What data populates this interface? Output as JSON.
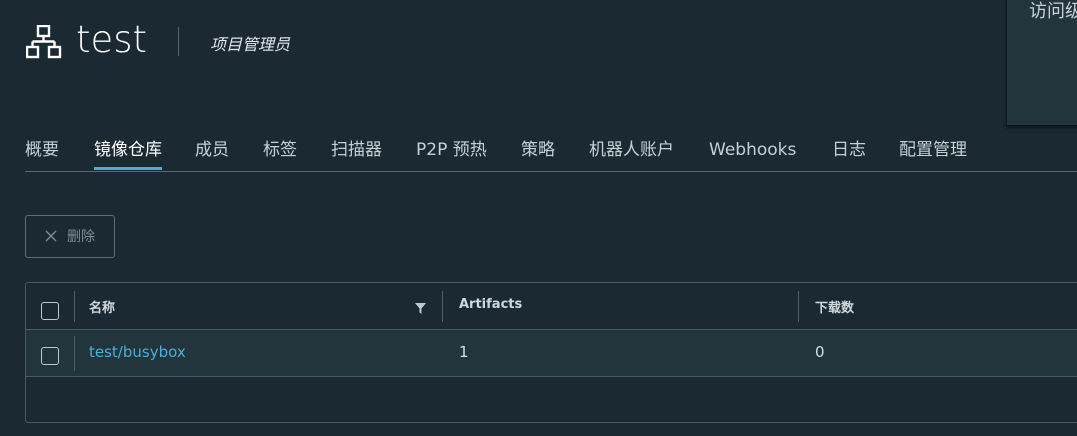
{
  "header": {
    "project_name": "test",
    "role": "项目管理员",
    "icon": "project-tree-icon"
  },
  "popover": {
    "text": "访问级别"
  },
  "tabs": [
    {
      "label": "概要",
      "active": false
    },
    {
      "label": "镜像仓库",
      "active": true
    },
    {
      "label": "成员",
      "active": false
    },
    {
      "label": "标签",
      "active": false
    },
    {
      "label": "扫描器",
      "active": false
    },
    {
      "label": "P2P 预热",
      "active": false
    },
    {
      "label": "策略",
      "active": false
    },
    {
      "label": "机器人账户",
      "active": false
    },
    {
      "label": "Webhooks",
      "active": false
    },
    {
      "label": "日志",
      "active": false
    },
    {
      "label": "配置管理",
      "active": false
    }
  ],
  "toolbar": {
    "delete_label": "删除",
    "delete_enabled": false
  },
  "grid": {
    "columns": [
      "名称",
      "Artifacts",
      "下载数"
    ],
    "rows": [
      {
        "name": "test/busybox",
        "artifacts": "1",
        "downloads": "0"
      }
    ]
  },
  "colors": {
    "background": "#1b2a32",
    "accent": "#49afd9",
    "row_background": "#22343c",
    "border": "#4a5a63"
  }
}
